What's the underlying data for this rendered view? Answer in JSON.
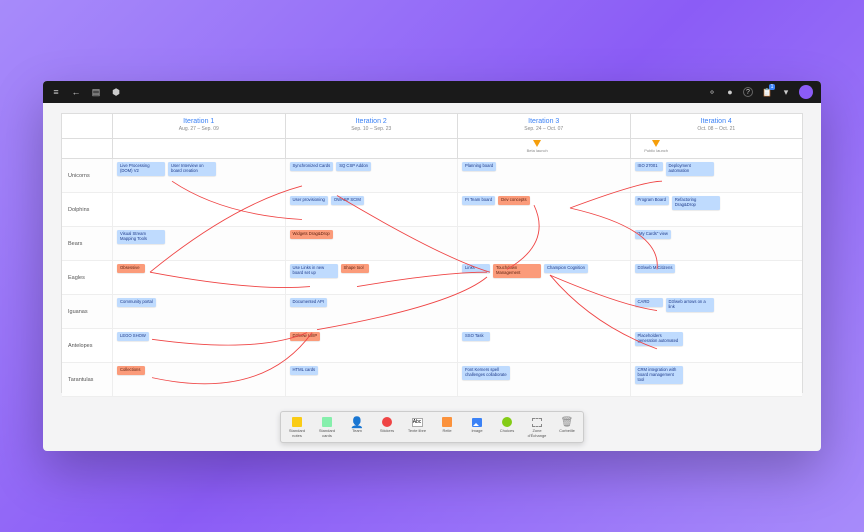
{
  "topbar": {
    "menu_icon": "≡",
    "back_icon": "←",
    "board_icon": "▤",
    "app_icon": "⬢",
    "share_icon": "⚬",
    "help_icon": "?",
    "clipboard_badge": "1"
  },
  "iterations": [
    {
      "title": "Iteration 1",
      "dates": "Aug. 27 – Sep. 09"
    },
    {
      "title": "Iteration 2",
      "dates": "Sep. 10 – Sep. 23"
    },
    {
      "title": "Iteration 3",
      "dates": "Sep. 24 – Oct. 07"
    },
    {
      "title": "Iteration 4",
      "dates": "Oct. 08 – Oct. 21"
    }
  ],
  "milestones": {
    "iter3": [
      {
        "pos": 40,
        "label": "Beta launch"
      }
    ],
    "iter4": [
      {
        "pos": 8,
        "label": "Public launch"
      }
    ]
  },
  "rows": [
    {
      "team": "Unicorns",
      "cells": [
        [
          {
            "t": "Live Processing (DOM) V2",
            "c": "blue"
          },
          {
            "t": "User Interview on board creation",
            "c": "blue"
          }
        ],
        [
          {
            "t": "Synchronized Cards",
            "c": "blue"
          },
          {
            "t": "SQ CSP Addon",
            "c": "blue"
          }
        ],
        [
          {
            "t": "Planning board",
            "c": "blue"
          }
        ],
        [
          {
            "t": "ISO 27001",
            "c": "blue"
          },
          {
            "t": "Deployment automation",
            "c": "blue"
          }
        ]
      ]
    },
    {
      "team": "Dolphins",
      "cells": [
        [],
        [
          {
            "t": "User provisioning",
            "c": "blue"
          },
          {
            "t": "OWASP SCIM",
            "c": "blue"
          }
        ],
        [
          {
            "t": "PI Team board",
            "c": "blue"
          },
          {
            "t": "Dev concepts",
            "c": "orange"
          }
        ],
        [
          {
            "t": "Program Board",
            "c": "blue"
          },
          {
            "t": "Refactoring Drag&Drop",
            "c": "blue"
          }
        ]
      ]
    },
    {
      "team": "Bears",
      "cells": [
        [
          {
            "t": "Visual Stream Mapping Tools",
            "c": "blue"
          }
        ],
        [
          {
            "t": "Widgets Drag&Drop",
            "c": "orange"
          }
        ],
        [],
        [
          {
            "t": "\"My Cards\" view",
            "c": "blue"
          }
        ]
      ]
    },
    {
      "team": "Eagles",
      "cells": [
        [
          {
            "t": "Obsessive",
            "c": "orange"
          }
        ],
        [
          {
            "t": "Use Links in new board set up",
            "c": "blue"
          },
          {
            "t": "Shape tool",
            "c": "orange"
          }
        ],
        [
          {
            "t": "Links",
            "c": "blue"
          },
          {
            "t": "Touchdown Management",
            "c": "orange"
          },
          {
            "t": "Champion Cognition",
            "c": "blue"
          }
        ],
        [
          {
            "t": "D3/web M Citizens",
            "c": "blue"
          }
        ]
      ]
    },
    {
      "team": "Iguanas",
      "cells": [
        [
          {
            "t": "Community portal",
            "c": "blue"
          }
        ],
        [
          {
            "t": "Documented API",
            "c": "blue"
          }
        ],
        [],
        [
          {
            "t": "CARD",
            "c": "blue"
          },
          {
            "t": "D3/web arrows on a link",
            "c": "blue"
          }
        ]
      ]
    },
    {
      "team": "Antelopes",
      "cells": [
        [
          {
            "t": "LEGO SHOW",
            "c": "blue"
          }
        ],
        [
          {
            "t": "D3/new UI/IP",
            "c": "orange"
          }
        ],
        [
          {
            "t": "SSO Task",
            "c": "blue"
          }
        ],
        [
          {
            "t": "Placeholders generation automated",
            "c": "blue"
          }
        ]
      ]
    },
    {
      "team": "Tarantulas",
      "cells": [
        [
          {
            "t": "Collections",
            "c": "orange"
          }
        ],
        [
          {
            "t": "HTML cards",
            "c": "blue"
          }
        ],
        [
          {
            "t": "Font Kerners spell challenges collaborate",
            "c": "blue"
          }
        ],
        [
          {
            "t": "CRM integration with board management tool",
            "c": "blue"
          }
        ]
      ]
    }
  ],
  "toolbar": [
    {
      "label": "Standard notes",
      "color": "#facc15",
      "shape": "square"
    },
    {
      "label": "Standard cards",
      "color": "#86efac",
      "shape": "square"
    },
    {
      "label": "Team",
      "color": "#3b82f6",
      "shape": "person"
    },
    {
      "label": "Stickers",
      "color": "#ef4444",
      "shape": "circle"
    },
    {
      "label": "Texte libre",
      "color": "#fff",
      "shape": "text"
    },
    {
      "label": "Relie",
      "color": "#fb923c",
      "shape": "square"
    },
    {
      "label": "Image",
      "color": "#3b82f6",
      "shape": "image"
    },
    {
      "label": "Choices",
      "color": "#84cc16",
      "shape": "circle"
    },
    {
      "label": "Zone d'Échange",
      "color": "#9ca3af",
      "shape": "zone"
    },
    {
      "label": "Corbeille",
      "color": "#9ca3af",
      "shape": "trash"
    }
  ]
}
